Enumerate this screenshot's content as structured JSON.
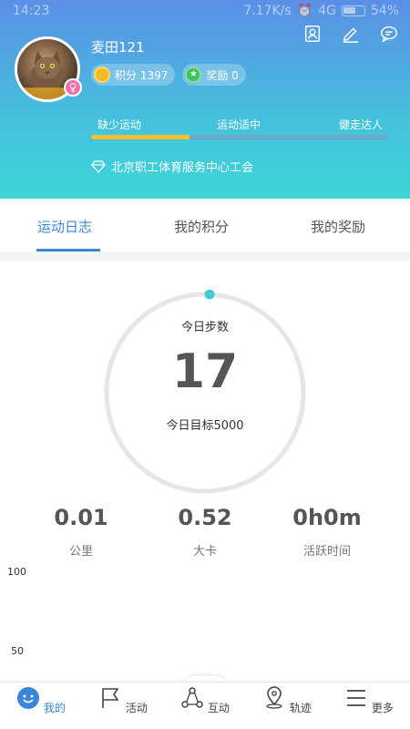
{
  "status_bar": {
    "time": "14:23",
    "network_speed": "7.17K/s",
    "signal": "4G",
    "battery": "54%"
  },
  "profile": {
    "username": "麦田121",
    "points_label": "积分 1397",
    "rewards_label": "奖励 0",
    "gender": "♀",
    "levels": [
      "缺少运动",
      "运动适中",
      "健走达人"
    ],
    "level_progress": 0.33,
    "organization": "北京职工体育服务中心工会"
  },
  "tabs": [
    "运动日志",
    "我的积分",
    "我的奖励"
  ],
  "steps": {
    "label": "今日步数",
    "value": "17",
    "goal": "今日目标5000"
  },
  "stats": [
    {
      "value": "0.01",
      "label": "公里"
    },
    {
      "value": "0.52",
      "label": "大卡"
    },
    {
      "value": "0h0m",
      "label": "活跃时间"
    }
  ],
  "chart_axis": [
    "100",
    "50"
  ],
  "nav": [
    "我的",
    "活动",
    "互动",
    "轨迹",
    "更多"
  ],
  "colors": {
    "accent": "#3b86d8",
    "header_top": "#5b8fe6",
    "header_bottom": "#3dd6d8",
    "progress": "#f3c12a"
  }
}
